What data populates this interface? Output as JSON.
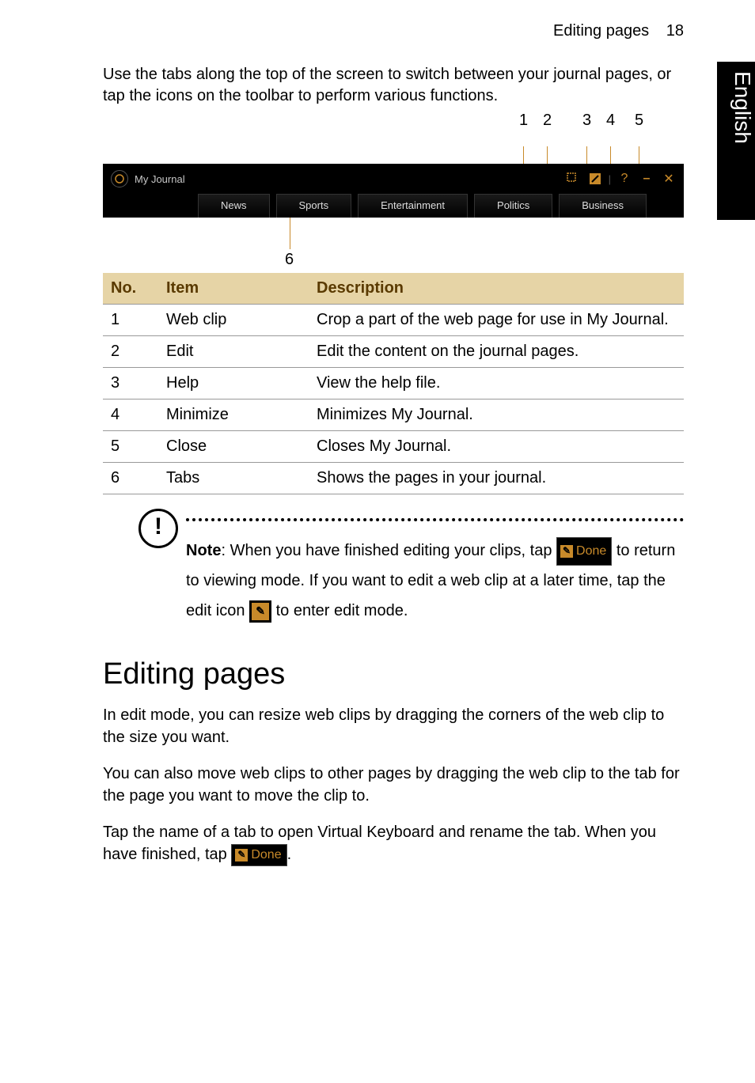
{
  "side_tab": "English",
  "header": {
    "title": "Editing pages",
    "page_number": "18"
  },
  "intro": "Use the tabs along the top of the screen to switch between your journal pages, or tap the icons on the toolbar to perform various functions.",
  "callouts_top": [
    "1",
    "2",
    "3",
    "4",
    "5"
  ],
  "toolbar": {
    "app_title": "My Journal",
    "icons": {
      "webclip": "webclip-icon",
      "edit": "edit-icon",
      "help": "?",
      "minimize": "–",
      "close": "✕"
    },
    "tabs": [
      "News",
      "Sports",
      "Entertainment",
      "Politics",
      "Business"
    ]
  },
  "callout_bottom": "6",
  "table": {
    "headers": {
      "no": "No.",
      "item": "Item",
      "desc": "Description"
    },
    "rows": [
      {
        "no": "1",
        "item": "Web clip",
        "desc": "Crop a part of the web page for use in My Journal."
      },
      {
        "no": "2",
        "item": "Edit",
        "desc": "Edit the content on the journal pages."
      },
      {
        "no": "3",
        "item": "Help",
        "desc": "View the help file."
      },
      {
        "no": "4",
        "item": "Minimize",
        "desc": "Minimizes My Journal."
      },
      {
        "no": "5",
        "item": "Close",
        "desc": "Closes My Journal."
      },
      {
        "no": "6",
        "item": "Tabs",
        "desc": "Shows the pages in your journal."
      }
    ]
  },
  "note": {
    "bold": "Note",
    "part1": ": When you have finished editing your clips, tap ",
    "done_label": "Done",
    "part2": " to return to viewing mode. If you want to edit a web clip at a later time, tap the edit icon ",
    "part3": " to enter edit mode."
  },
  "section_heading": "Editing pages",
  "paragraphs": {
    "p1": "In edit mode, you can resize web clips by dragging the corners of the web clip to the size you want.",
    "p2": "You can also move web clips to other pages by dragging the web clip to the tab for the page you want to move the clip to.",
    "p3a": "Tap the name of a tab to open Virtual Keyboard and rename the tab. When you have finished, tap ",
    "p3b": "."
  }
}
